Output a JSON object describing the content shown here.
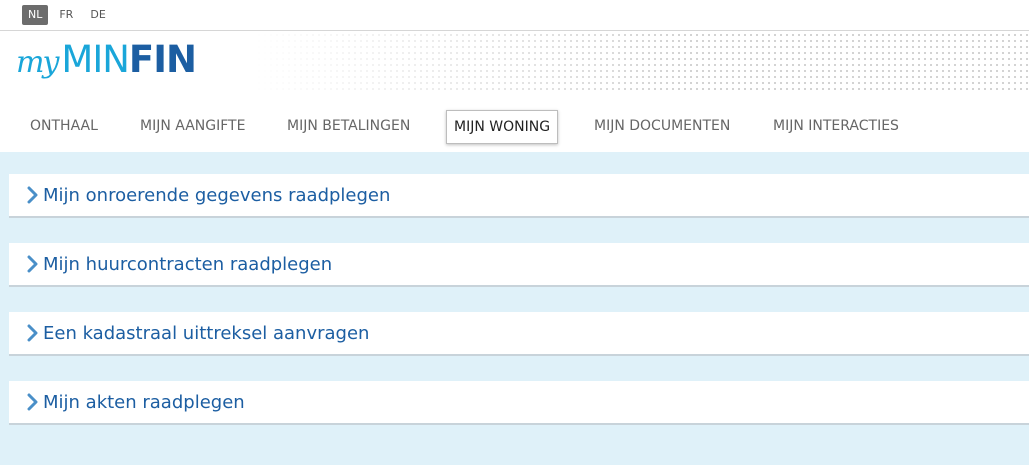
{
  "languages": [
    {
      "code": "NL",
      "active": true
    },
    {
      "code": "FR",
      "active": false
    },
    {
      "code": "DE",
      "active": false
    }
  ],
  "logo": {
    "my": "my",
    "min": "MIN",
    "fin": "FIN"
  },
  "nav": {
    "items": [
      {
        "label": "ONTHAAL"
      },
      {
        "label": "MIJN AANGIFTE"
      },
      {
        "label": "MIJN BETALINGEN"
      },
      {
        "label": "MIJN WONING",
        "active": true
      },
      {
        "label": "MIJN DOCUMENTEN"
      },
      {
        "label": "MIJN INTERACTIES"
      }
    ]
  },
  "panels": [
    {
      "title": "Mijn onroerende gegevens raadplegen"
    },
    {
      "title": "Mijn huurcontracten raadplegen"
    },
    {
      "title": "Een kadastraal uittreksel aanvragen"
    },
    {
      "title": "Mijn akten raadplegen"
    }
  ],
  "colors": {
    "accent": "#1c5ea2",
    "logo_light": "#1aa6d9",
    "content_bg": "#dff1f9",
    "chevron": "#4a8fc8"
  }
}
